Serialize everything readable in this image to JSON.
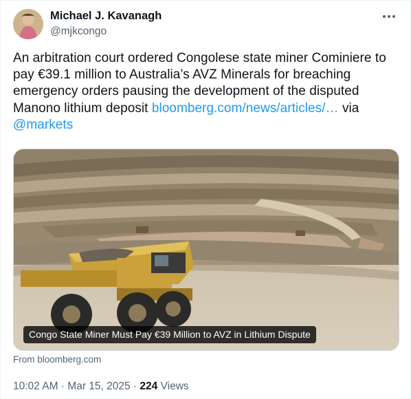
{
  "author": {
    "name": "Michael J. Kavanagh",
    "handle": "@mjkcongo",
    "avatar_icon": "avatar-photo"
  },
  "more_icon": "more-horizontal-icon",
  "tweet": {
    "text_before_link": "An arbitration court ordered Congolese state miner Cominiere to pay €39.1 million to Australia’s AVZ Minerals for breaching emergency orders pausing the development of the disputed Manono lithium deposit ",
    "link_text": "bloomberg.com/news/articles/…",
    "text_between": " via ",
    "mention": "@markets"
  },
  "card": {
    "title": "Congo State Miner Must Pay €39 Million to AVZ in Lithium Dispute",
    "source": "From bloomberg.com"
  },
  "meta": {
    "time": "10:02 AM",
    "separator1": " · ",
    "date": "Mar 15, 2025",
    "separator2": " · ",
    "views_count": "224",
    "views_label": " Views"
  },
  "colors": {
    "link": "#1d9bf0",
    "secondary_text": "#536471",
    "primary_text": "#0f1419"
  }
}
